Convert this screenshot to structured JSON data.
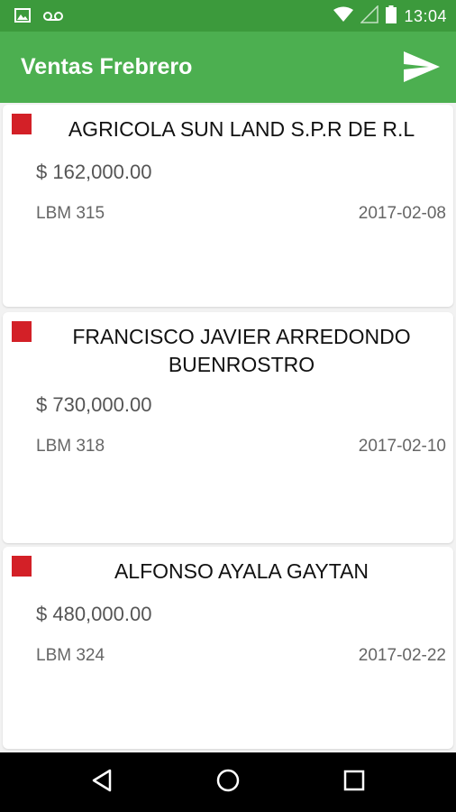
{
  "status_bar": {
    "time": "13:04",
    "icons": [
      "image-icon",
      "voicemail-icon",
      "wifi-icon",
      "signal-icon",
      "battery-icon"
    ]
  },
  "app_bar": {
    "title": "Ventas Frebrero",
    "action_icon": "send-icon"
  },
  "sales": [
    {
      "client": "AGRICOLA SUN LAND S.P.R DE R.L",
      "amount": "$ 162,000.00",
      "code": "LBM 315",
      "date": "2017-02-08",
      "flag_color": "#d32027"
    },
    {
      "client": "FRANCISCO JAVIER ARREDONDO BUENROSTRO",
      "amount": "$ 730,000.00",
      "code": "LBM 318",
      "date": "2017-02-10",
      "flag_color": "#d32027"
    },
    {
      "client": "ALFONSO AYALA GAYTAN",
      "amount": "$ 480,000.00",
      "code": "LBM 324",
      "date": "2017-02-22",
      "flag_color": "#d32027"
    }
  ],
  "nav_bar": {
    "buttons": [
      "back-icon",
      "home-icon",
      "recents-icon"
    ]
  },
  "colors": {
    "status_bar": "#3c9a3c",
    "app_bar": "#4caf50",
    "flag": "#d32027"
  }
}
